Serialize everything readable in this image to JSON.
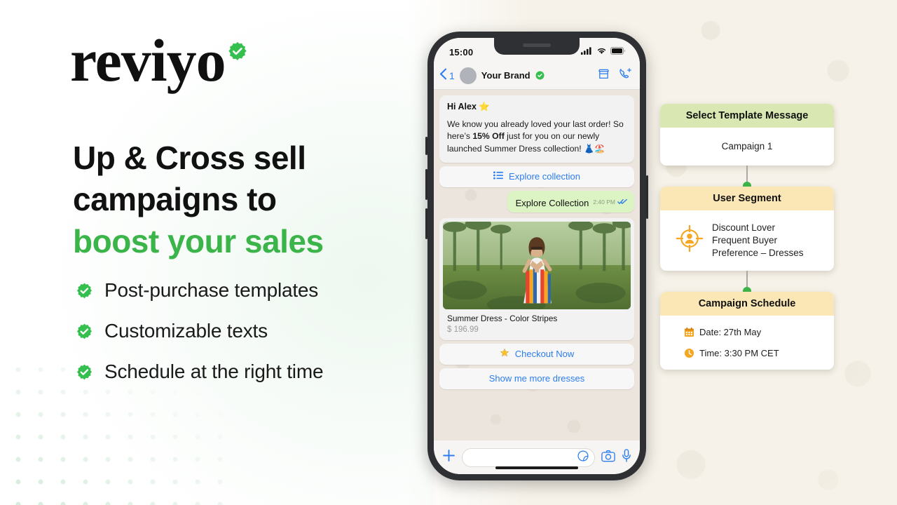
{
  "brand": {
    "logo_text": "reviyo",
    "verified_icon": "verified-badge-icon",
    "accent_green": "#3bb54a",
    "accent_blue": "#2c7df0"
  },
  "hero": {
    "headline_line1": "Up & Cross sell",
    "headline_line2": "campaigns to",
    "headline_accent": "boost your sales",
    "features": [
      {
        "icon": "check-badge-icon",
        "label": "Post-purchase templates"
      },
      {
        "icon": "check-badge-icon",
        "label": "Customizable texts"
      },
      {
        "icon": "check-badge-icon",
        "label": "Schedule at the right time"
      }
    ]
  },
  "phone": {
    "status_bar": {
      "time": "15:00",
      "icons": [
        "cellular-signal-icon",
        "wifi-icon",
        "battery-icon"
      ]
    },
    "chat_header": {
      "back_icon": "chevron-left-icon",
      "back_count": "1",
      "avatar": "contact-avatar",
      "contact_name": "Your Brand",
      "verified_icon": "verified-badge-icon",
      "actions": [
        "storefront-icon",
        "add-call-icon"
      ]
    },
    "messages": {
      "template_bubble": {
        "title": "Hi Alex ⭐",
        "body_before": "We know you already loved your last order! So here’s ",
        "body_bold": "15% Off",
        "body_after": " just for you on our newly launched Summer Dress collection! 👗🏖️"
      },
      "quick_reply_explore": {
        "icon": "list-icon",
        "label": "Explore collection"
      },
      "outgoing": {
        "text": "Explore Collection",
        "time": "2:40 PM",
        "status_icon": "read-double-check-icon"
      },
      "product": {
        "image_alt": "woman-in-striped-summer-dress-photo",
        "title": "Summer Dress - Color Stripes",
        "price": "$ 196.99"
      },
      "quick_reply_checkout": {
        "icon": "star-icon",
        "label": "Checkout Now"
      },
      "quick_reply_more": {
        "label": "Show me more dresses"
      }
    },
    "composer": {
      "plus_icon": "plus-icon",
      "input_value": "",
      "input_placeholder": "",
      "sticker_icon": "sticker-icon",
      "camera_icon": "camera-icon",
      "mic_icon": "microphone-icon"
    }
  },
  "flow": {
    "cards": [
      {
        "title": "Select Template Message",
        "header_color": "#d9e8b2",
        "body_text": "Campaign 1",
        "icon": null
      },
      {
        "title": "User Segment",
        "header_color": "#fbe7b6",
        "icon": "target-user-icon",
        "lines": [
          "Discount Lover",
          "Frequent Buyer",
          "Preference – Dresses"
        ]
      },
      {
        "title": "Campaign Schedule",
        "header_color": "#fbe7b6",
        "rows": [
          {
            "icon": "calendar-icon",
            "label": "Date: 27th May"
          },
          {
            "icon": "clock-icon",
            "label": "Time: 3:30 PM CET"
          }
        ]
      }
    ],
    "connector_dot_color": "#3eb54a"
  }
}
